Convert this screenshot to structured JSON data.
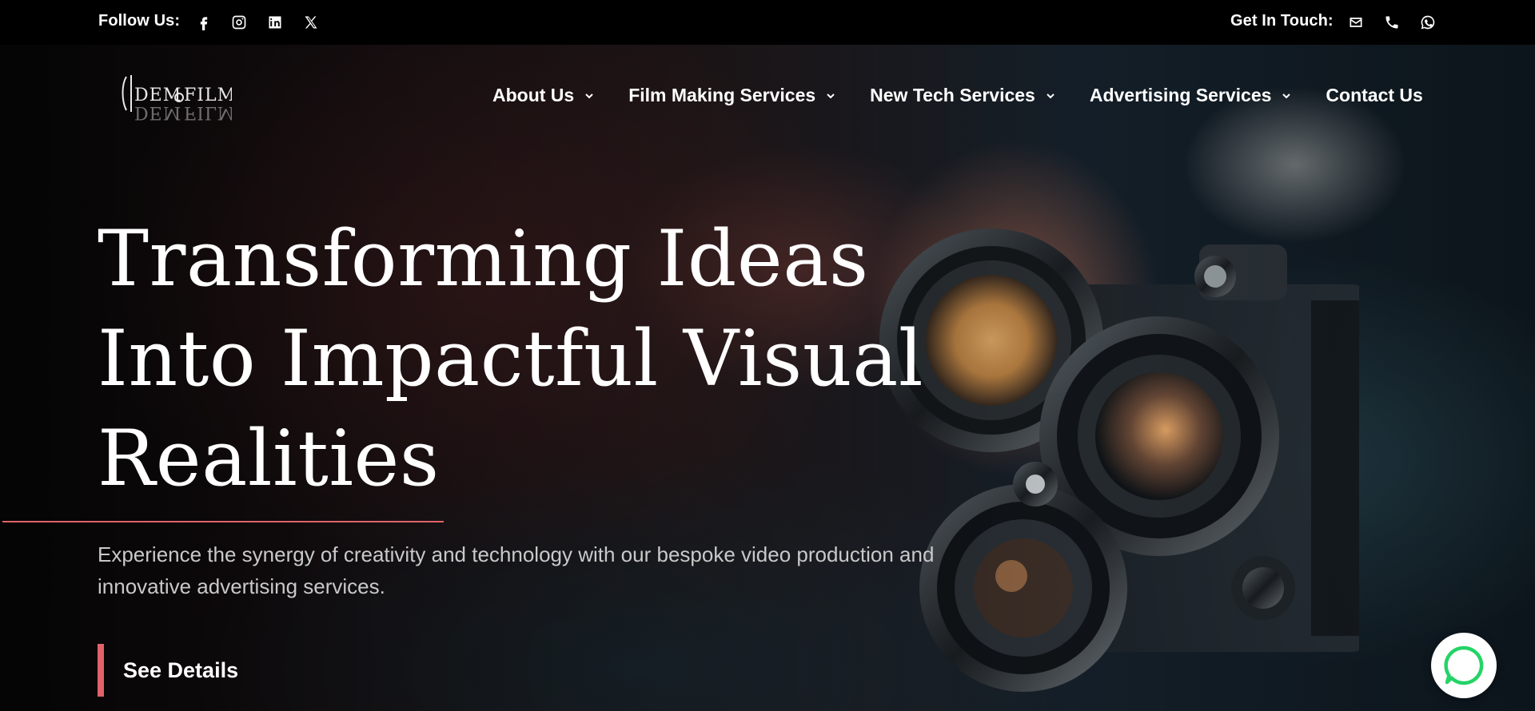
{
  "topbar": {
    "follow_label": "Follow Us:",
    "touch_label": "Get In Touch:",
    "social_icons": [
      "facebook-icon",
      "instagram-icon",
      "linkedin-icon",
      "x-icon"
    ],
    "contact_icons": [
      "mail-icon",
      "phone-icon",
      "whatsapp-icon"
    ]
  },
  "header": {
    "logo_text": "DEMOFILM",
    "nav": [
      {
        "label": "About Us",
        "has_dropdown": true
      },
      {
        "label": "Film Making Services",
        "has_dropdown": true
      },
      {
        "label": "New Tech Services",
        "has_dropdown": true
      },
      {
        "label": "Advertising Services",
        "has_dropdown": true
      },
      {
        "label": "Contact Us",
        "has_dropdown": false
      }
    ]
  },
  "hero": {
    "headline_lines": [
      "Transforming Ideas",
      "Into Impactful Visual",
      "Realities"
    ],
    "subtext": "Experience the synergy of creativity and technology with our bespoke video production and innovative advertising services.",
    "cta_label": "See Details"
  },
  "colors": {
    "accent": "#e0636a",
    "topbar_bg": "#000000",
    "chat_green": "#25d366"
  }
}
